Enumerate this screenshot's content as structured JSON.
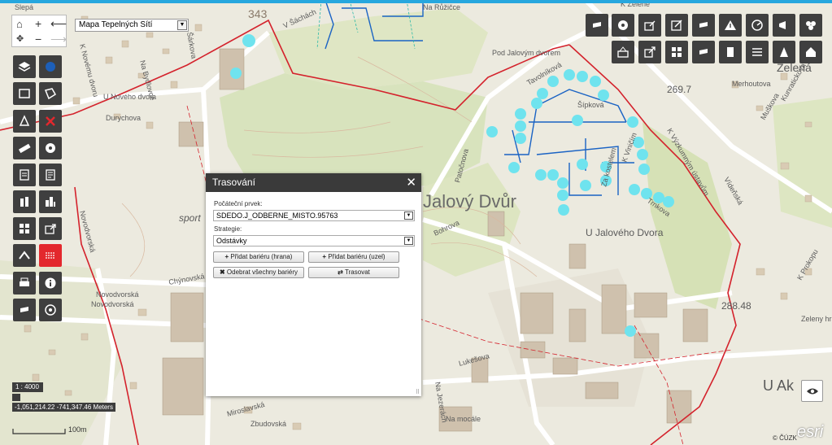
{
  "nav": {
    "home_icon": "home-icon",
    "zoom_in": "+",
    "zoom_out": "−",
    "back": "⟵",
    "forward": "⟶"
  },
  "layer_select": {
    "value": "Mapa Tepelných Sítí"
  },
  "dialog": {
    "title": "Trasování",
    "start_label": "Počáteční prvek:",
    "start_value": "SDEDO.J_ODBERNE_MISTO.95763",
    "strategy_label": "Strategie:",
    "strategy_value": "Odstávky",
    "btn_barrier_edge": "Přidat bariéru (hrana)",
    "btn_barrier_node": "Přidat bariéru (uzel)",
    "btn_remove_barriers": "Odebrat všechny bariéry",
    "btn_trace": "Trasovat"
  },
  "status": {
    "scale": "1 : 4000",
    "coords": "-1,051,214.22 -741,347.46 Meters",
    "scalebar": "100m"
  },
  "attribution": {
    "cuzk": "© ČÚZK",
    "esri": "esri"
  },
  "map_labels": {
    "slepa": "Slepá",
    "sarkova": "Šárkova",
    "ve_sachach": "V Šáchách",
    "na_ruzicce": "Na Růžičce",
    "k_novemu_dvoru": "K Novému dvoru",
    "na_bydlovce": "Na Bydlovce",
    "u_noveho_dvora": "U Nového dvora",
    "durychova": "Durychova",
    "pod_jalovym_dvorem": "Pod Jalovým dvorem",
    "k_zelene": "K Zelené",
    "zelena": "Zelená",
    "tavolnikova": "Tavolníková",
    "sipkova": "Šípková",
    "num_2697": "269.7",
    "merhoutova": "Merhoutova",
    "muskova": "Muškova",
    "kunratickova": "Kunratickova",
    "jalovy_dvur": "Jalový Dvůr",
    "patocnova": "Patočnova",
    "bohrova": "Bohrova",
    "u_jaloveho_dvora": "U Jalového Dvora",
    "trnkova": "Trnkova",
    "k_vinicim": "K Viničím",
    "za_kostelem": "Za kostelem",
    "vojtesska": "Vídeňská",
    "k_vyskumnym_ustavum": "K Výzkumným ústavům",
    "sportovni": "sport",
    "novodvorska": "Novodvorská",
    "chynovska": "Chýnovská",
    "lukesova": "Lukešova",
    "na_jezerach": "Na Jezerách",
    "na_mocale": "Na mocále",
    "mirovska": "Miroslavská",
    "zbudovska": "Zbudovská",
    "num_28848": "288.48",
    "u_akaty": "U Ak",
    "k_prokopu": "K Prokopu",
    "zelenov_zahrada": "Zeleny hrad",
    "num_343": "343"
  }
}
